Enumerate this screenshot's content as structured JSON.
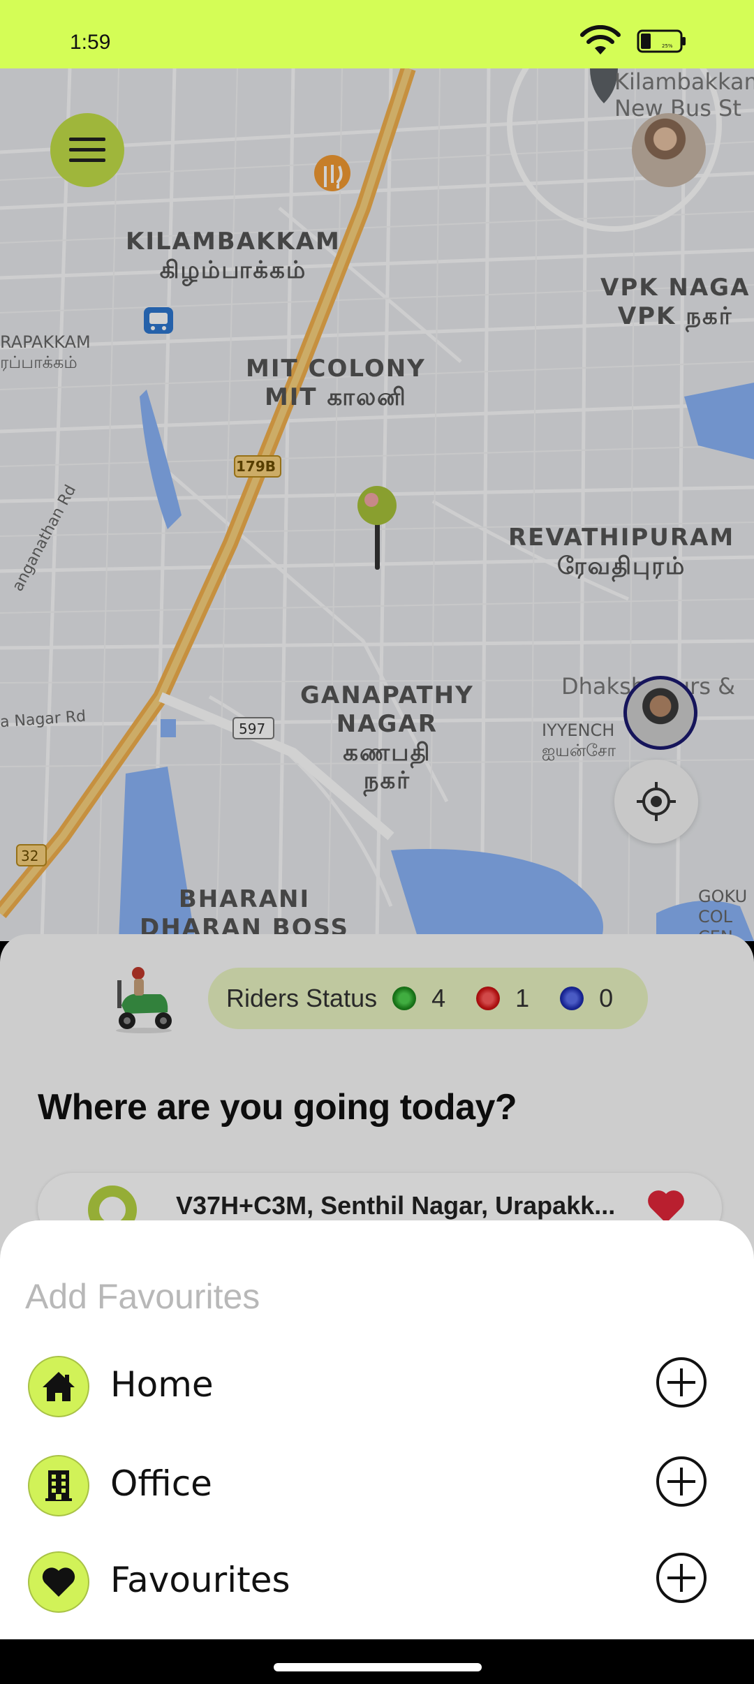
{
  "status_bar": {
    "time": "1:59",
    "battery_label": "25%"
  },
  "map": {
    "labels": [
      {
        "name": "kilambakkam",
        "text": "KILAMBAKKAM\nகிழம்பாக்கம்"
      },
      {
        "name": "mit-colony",
        "text": "MIT COLONY\nMIT காலனி"
      },
      {
        "name": "vpk-nagar",
        "text": "VPK NAGA\nVPK நகர்"
      },
      {
        "name": "revathipuram",
        "text": "REVATHIPURAM\nரேவதிபுரம்"
      },
      {
        "name": "ganapathy-nagar",
        "text": "GANAPATHY\nNAGAR\nகணபதி\nநகர்"
      },
      {
        "name": "bharani",
        "text": "BHARANI\nDHARAN BOSS"
      },
      {
        "name": "urapakkam-partial",
        "text": "RAPAKKAM\nரப்பாக்கம்"
      },
      {
        "name": "kilambakkam-bus-stand",
        "text": "Kilambakkam\nNew Bus St"
      },
      {
        "name": "iyyenchery",
        "text": "IYYENCH\nஐயன்சோ"
      },
      {
        "name": "gokul",
        "text": "GOKU\nCOL\nCEN"
      },
      {
        "name": "dhaksha-tours",
        "text": "Dhaksh Tours &"
      },
      {
        "name": "ranganathan-rd",
        "text": "anganathan Rd"
      },
      {
        "name": "nagar-rd",
        "text": "a Nagar Rd"
      }
    ],
    "road_shields": [
      "179B",
      "597",
      "32"
    ]
  },
  "riders_status": {
    "label": "Riders Status",
    "green_count": "4",
    "red_count": "1",
    "blue_count": "0"
  },
  "question": "Where are you going today?",
  "recent_address": "V37H+C3M, Senthil Nagar, Urapakk...",
  "sheet": {
    "title": "Add Favourites",
    "items": [
      {
        "label": "Home",
        "icon": "home-icon"
      },
      {
        "label": "Office",
        "icon": "building-icon"
      },
      {
        "label": "Favourites",
        "icon": "heart-icon"
      }
    ]
  },
  "colors": {
    "accent": "#d4fd56",
    "icon_bg": "#d1f258",
    "heart": "#e2263a"
  }
}
